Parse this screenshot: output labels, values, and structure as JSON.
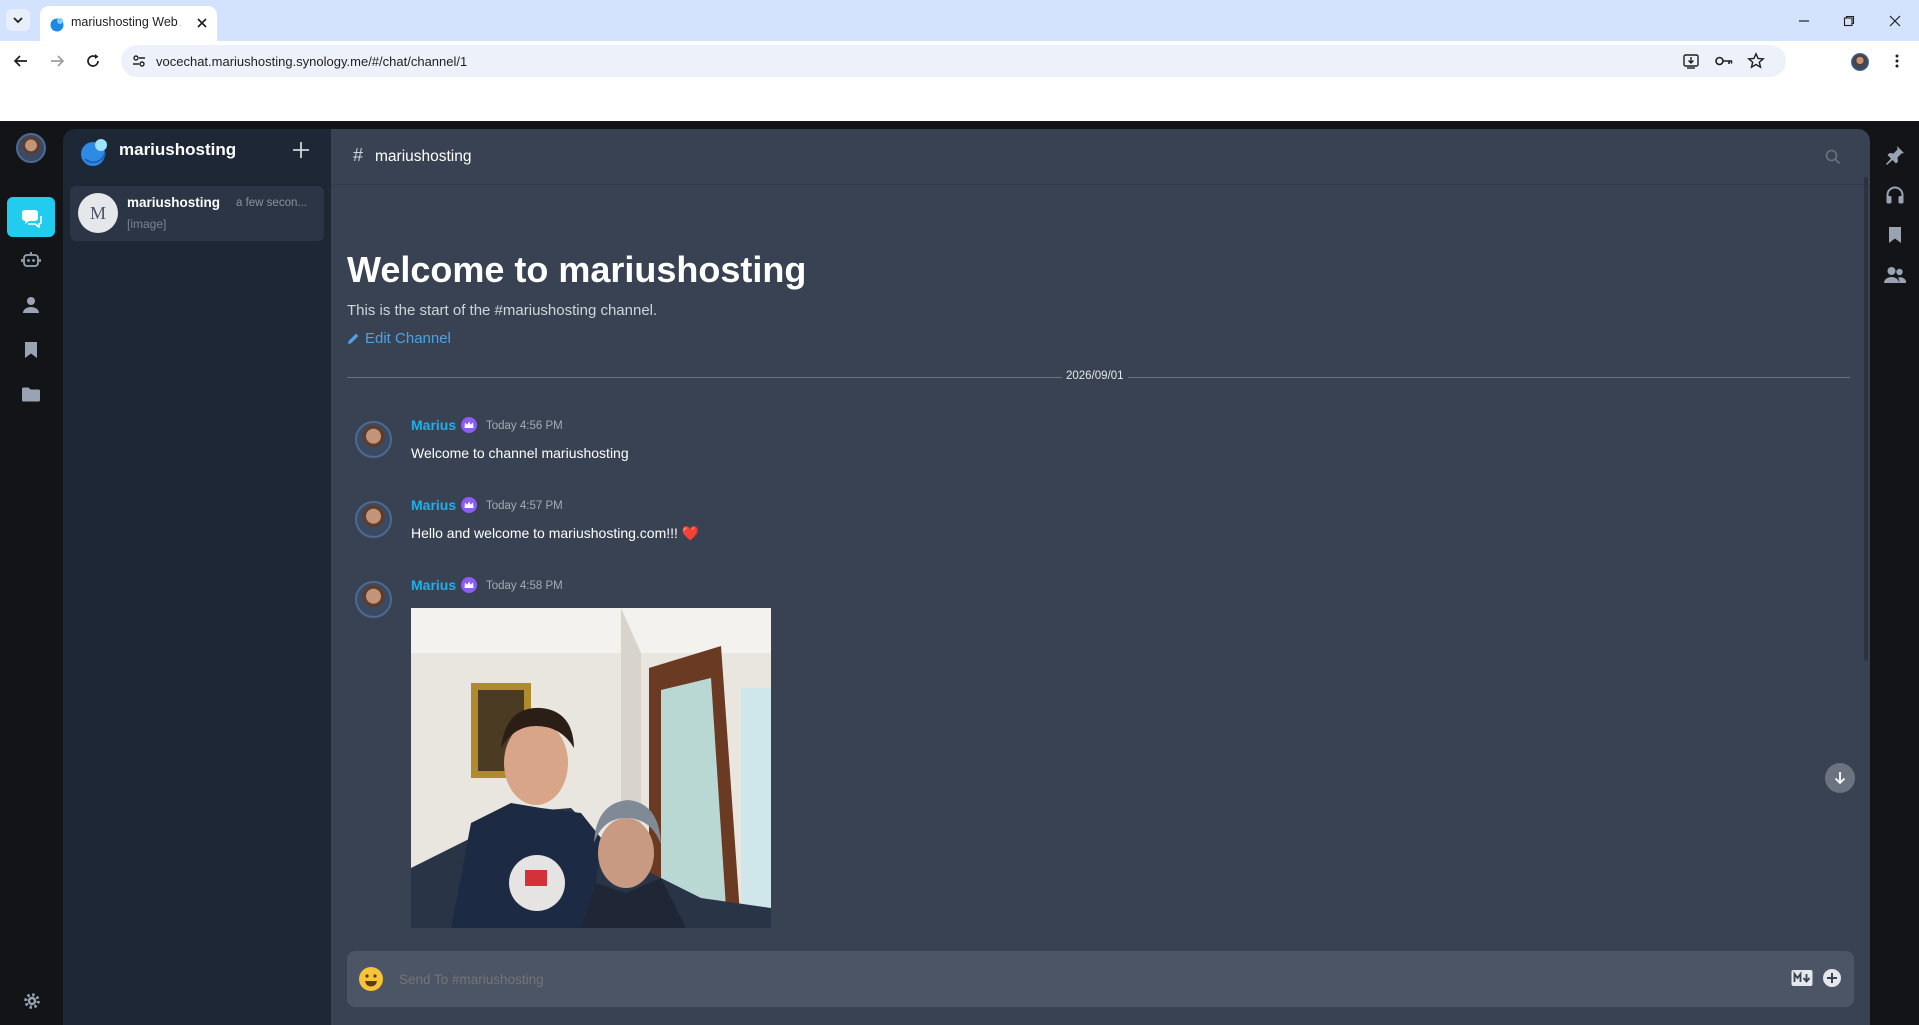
{
  "browser": {
    "tab_title": "mariushosting Web A",
    "url": "vocechat.mariushosting.synology.me/#/chat/channel/1"
  },
  "workspace": {
    "name": "mariushosting"
  },
  "sidebar": {
    "channels": [
      {
        "initial": "M",
        "name": "mariushosting",
        "time": "a few secon...",
        "preview": "[image]"
      }
    ]
  },
  "channel": {
    "header_title": "mariushosting",
    "welcome_title": "Welcome to mariushosting",
    "welcome_sub": "This is the start of the #mariushosting channel.",
    "edit_label": "Edit Channel",
    "date_divider": "2026/09/01"
  },
  "messages": [
    {
      "author": "Marius",
      "time": "Today 4:56 PM",
      "text": "Welcome to channel mariushosting"
    },
    {
      "author": "Marius",
      "time": "Today 4:57 PM",
      "text": "Hello and welcome to mariushosting.com!!! ❤️"
    },
    {
      "author": "Marius",
      "time": "Today 4:58 PM",
      "text": ""
    }
  ],
  "composer": {
    "placeholder": "Send To #mariushosting"
  },
  "colors": {
    "accent": "#22ccee",
    "link": "#4ba3e6",
    "main_bg": "#394252",
    "sidebar_bg": "#1e2735",
    "crown": "#8b5cf6"
  }
}
